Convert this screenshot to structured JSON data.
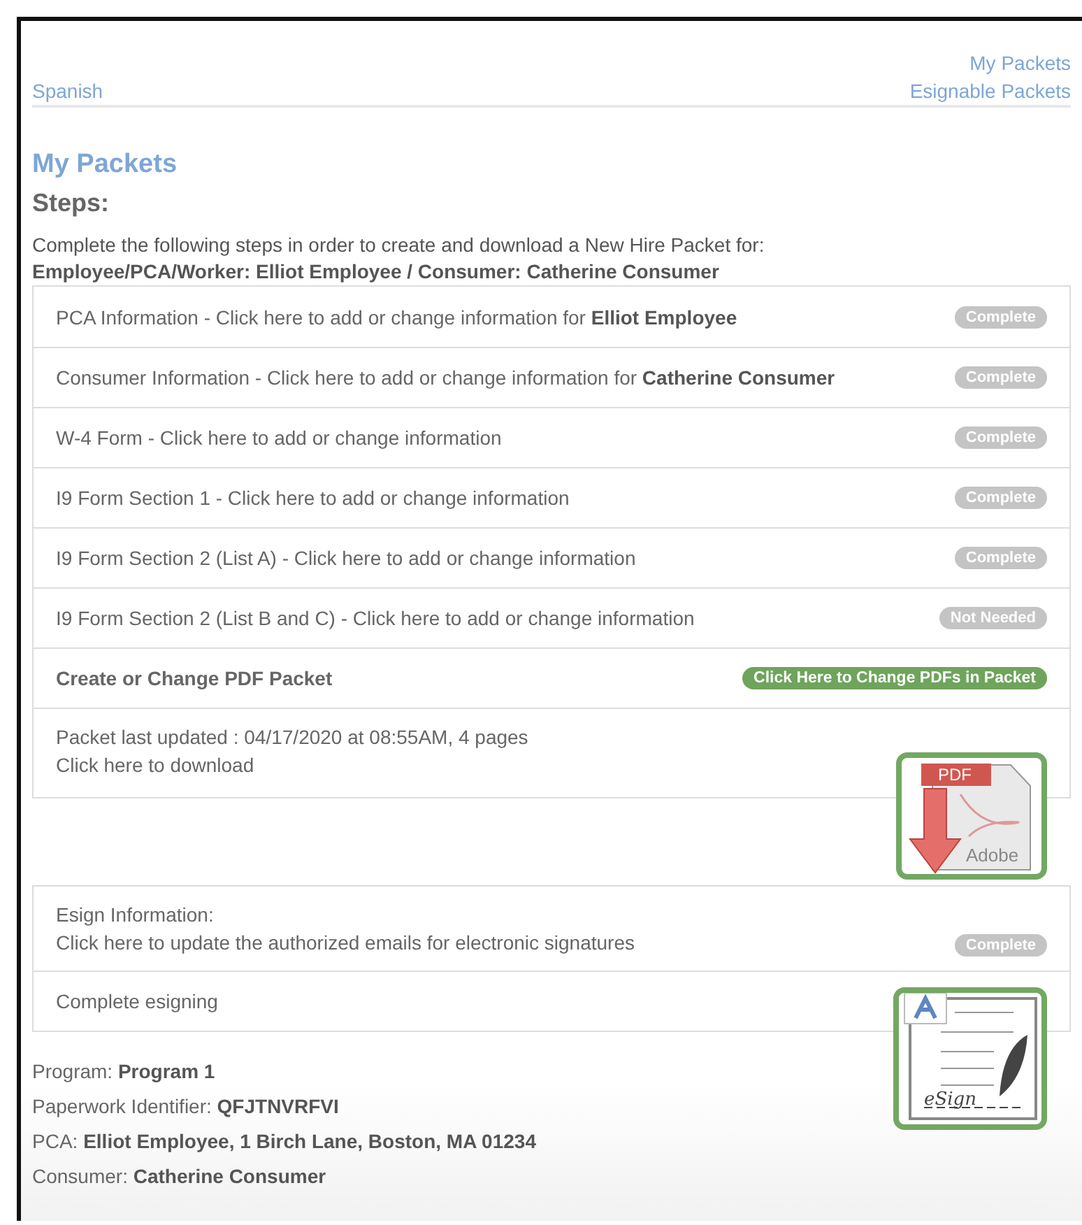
{
  "header": {
    "language_link": "Spanish",
    "nav_links": [
      "My Packets",
      "Esignable Packets"
    ]
  },
  "title": "My Packets",
  "steps_heading": "Steps:",
  "intro": "Complete the following steps in order to create and download a New Hire Packet for:",
  "subject": "Employee/PCA/Worker: Elliot Employee / Consumer: Catherine Consumer",
  "steps": [
    {
      "kind": "step",
      "lines": [
        "PCA Information - Click here to add or change information for **Elliot Employee**"
      ],
      "status": "Complete"
    },
    {
      "kind": "step",
      "lines": [
        "Consumer Information - Click here to add or change information for **Catherine Consumer**"
      ],
      "status": "Complete"
    },
    {
      "kind": "step",
      "lines": [
        "W-4 Form - Click here to add or change information"
      ],
      "status": "Complete"
    },
    {
      "kind": "step",
      "lines": [
        "I9 Form Section 1 - Click here to add or change information"
      ],
      "status": "Complete"
    },
    {
      "kind": "step",
      "lines": [
        "I9 Form Section 2 (List A) - Click here to add or change information"
      ],
      "status": "Complete"
    },
    {
      "kind": "step",
      "lines": [
        "I9 Form Section 2 (List B and C) - Click here to add or change information"
      ],
      "status": "Not Needed"
    },
    {
      "kind": "action",
      "lines": [
        "Create or Change PDF Packet"
      ],
      "button": "Click Here to Change PDFs in Packet"
    },
    {
      "kind": "download",
      "lines": [
        "Packet last updated : 04/17/2020 at 08:55AM, 4 pages",
        "Click here to download"
      ],
      "icon_texts": [
        "PDF",
        "Adobe"
      ]
    }
  ],
  "esign": [
    {
      "kind": "step",
      "lines": [
        "Esign Information:",
        "Click here to update the authorized emails for electronic signatures"
      ],
      "status": "Complete"
    },
    {
      "kind": "esign",
      "lines": [
        "Complete esigning"
      ],
      "icon_texts": [
        "eSign"
      ]
    }
  ],
  "details": [
    {
      "label": "Program:",
      "value": "Program 1"
    },
    {
      "label": "Paperwork Identifier:",
      "value": "QFJTNVRFVI"
    },
    {
      "label": "PCA:",
      "value": "Elliot Employee, 1 Birch Lane, Boston, MA 01234"
    },
    {
      "label": "Consumer:",
      "value": "Catherine Consumer"
    }
  ]
}
